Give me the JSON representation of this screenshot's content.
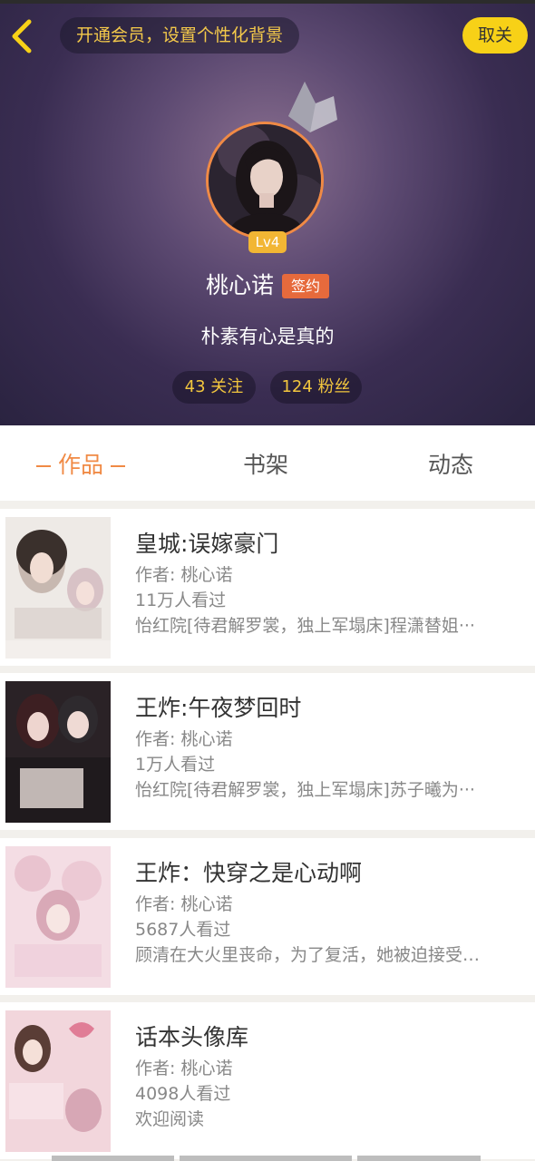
{
  "header": {
    "back_icon": "chevron-left-icon",
    "banner_text": "开通会员，设置个性化背景",
    "cancel_label": "取关",
    "level": "Lv4",
    "username": "桃心诺",
    "signed_tag": "签约",
    "bio": "朴素有心是真的",
    "following": "43 关注",
    "followers": "124 粉丝"
  },
  "tabs": {
    "works": "作品",
    "bookshelf": "书架",
    "activity": "动态"
  },
  "books": [
    {
      "title": "皇城:误嫁豪门",
      "author": "作者: 桃心诺",
      "views": "11万人看过",
      "desc": "怡红院[待君解罗裳，独上军塌床]程潇替姐···"
    },
    {
      "title": "王炸:午夜梦回时",
      "author": "作者: 桃心诺",
      "views": "1万人看过",
      "desc": "怡红院[待君解罗裳，独上军塌床]苏子曦为···"
    },
    {
      "title": "王炸：快穿之是心动啊",
      "author": "作者: 桃心诺",
      "views": "5687人看过",
      "desc": "顾清在大火里丧命，为了复活，她被迫接受…"
    },
    {
      "title": "话本头像库",
      "author": "作者: 桃心诺",
      "views": "4098人看过",
      "desc": "欢迎阅读"
    }
  ],
  "colors": {
    "accent": "#f08a45",
    "gold": "#f2c63e",
    "cancel_bg": "#f7d117",
    "signed_bg": "#e66a3c"
  }
}
